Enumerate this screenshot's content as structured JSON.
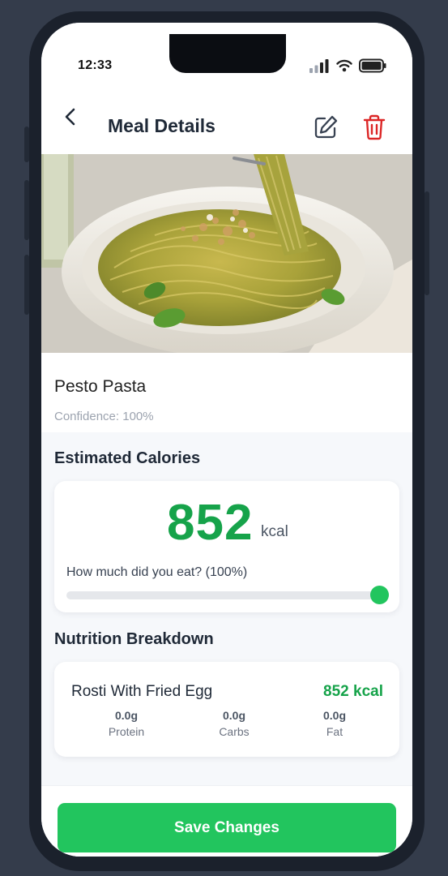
{
  "status_bar": {
    "time": "12:33"
  },
  "header": {
    "title": "Meal Details"
  },
  "meal": {
    "name": "Pesto Pasta",
    "confidence": "Confidence: 100%"
  },
  "calories": {
    "section_title": "Estimated Calories",
    "value": "852",
    "unit": "kcal",
    "portion_label": "How much did you eat? (100%)",
    "portion_fraction": 1.0
  },
  "nutrition": {
    "section_title": "Nutrition Breakdown",
    "item_name": "Rosti With Fried Egg",
    "item_kcal": "852 kcal",
    "macros": [
      {
        "value": "0.0g",
        "label": "Protein"
      },
      {
        "value": "0.0g",
        "label": "Carbs"
      },
      {
        "value": "0.0g",
        "label": "Fat"
      }
    ]
  },
  "footer": {
    "save_label": "Save Changes"
  },
  "colors": {
    "accent": "#22c55e",
    "accent_text": "#16a34a",
    "delete": "#dc2626"
  }
}
